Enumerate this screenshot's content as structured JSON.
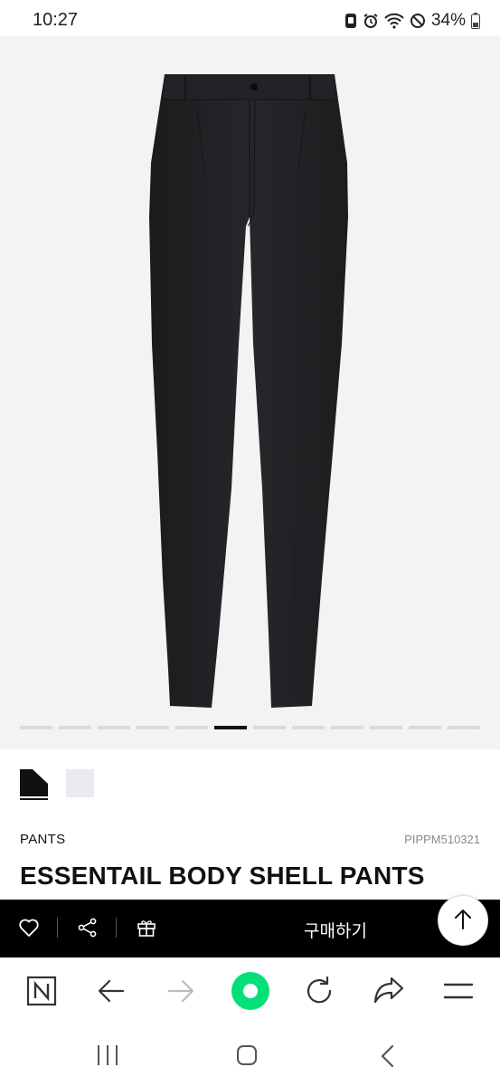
{
  "status_bar": {
    "time": "10:27",
    "battery": "34%",
    "icons": [
      "app-notification-icon",
      "alarm-icon",
      "wifi-icon",
      "do-not-disturb-icon",
      "battery-icon"
    ]
  },
  "gallery": {
    "slide_count": 12,
    "active_slide": 6,
    "background": "#f3f3f3"
  },
  "product": {
    "swatches": [
      {
        "color": "#111111",
        "name": "black"
      },
      {
        "color": "#e9ebee",
        "name": "light-gray"
      }
    ],
    "category": "PANTS",
    "code": "PIPPM510321",
    "title": "ESSENTAIL BODY SHELL PANTS"
  },
  "action_bar": {
    "icons": [
      "heart-icon",
      "share-icon",
      "gift-icon"
    ],
    "buy_label": "구매하기",
    "background": "#000000"
  },
  "browser_bar": {
    "icons": [
      "naver-n-icon",
      "back-arrow-icon",
      "forward-arrow-icon",
      "green-dot-icon",
      "refresh-icon",
      "share-forward-icon",
      "menu-icon"
    ],
    "accent": "#03e07a"
  },
  "system_nav": {
    "icons": [
      "recent-apps-icon",
      "home-icon",
      "back-icon"
    ]
  }
}
